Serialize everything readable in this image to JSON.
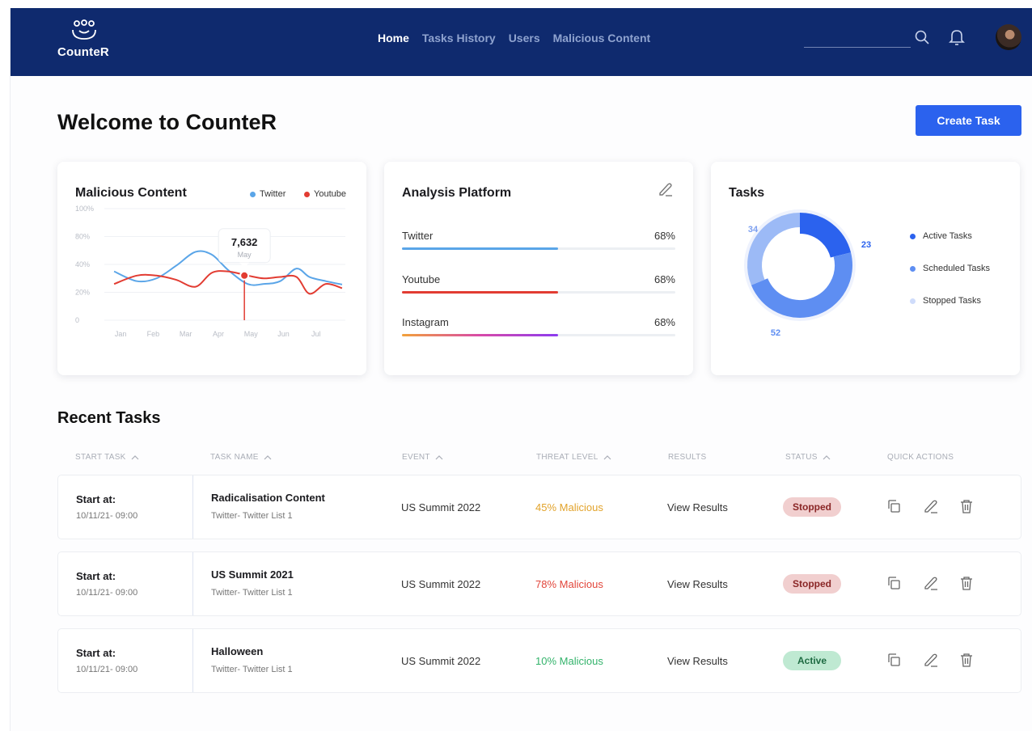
{
  "brand": {
    "name": "CounteR"
  },
  "nav": {
    "items": [
      {
        "label": "Home",
        "active": true
      },
      {
        "label": "Tasks History",
        "active": false
      },
      {
        "label": "Users",
        "active": false
      },
      {
        "label": "Malicious Content",
        "active": false
      }
    ]
  },
  "header": {
    "search_value": "",
    "icons": [
      "search-icon",
      "bell-icon",
      "avatar"
    ]
  },
  "page": {
    "title": "Welcome to CounteR",
    "create_button": "Create Task"
  },
  "malicious_card": {
    "title": "Malicious Content",
    "legend": [
      {
        "label": "Twitter",
        "color": "#5aa5e8"
      },
      {
        "label": "Youtube",
        "color": "#e23c32"
      }
    ],
    "tooltip": {
      "value": "7,632",
      "label": "May"
    }
  },
  "chart_data": {
    "type": "line",
    "title": "Malicious Content",
    "categories": [
      "Jan",
      "Feb",
      "Mar",
      "Apr",
      "May",
      "Jun",
      "Jul"
    ],
    "y_ticks": [
      "100%",
      "80%",
      "40%",
      "20%",
      "0"
    ],
    "ylim": [
      0,
      4
    ],
    "series": [
      {
        "name": "Twitter",
        "color": "#5aa5e8",
        "x": [
          0.3,
          1.0,
          1.6,
          2.2,
          2.8,
          3.3,
          3.8,
          4.4,
          4.9,
          5.4,
          5.9,
          6.3,
          6.8,
          7.3
        ],
        "y": [
          1.75,
          1.4,
          1.5,
          1.95,
          2.45,
          2.35,
          1.8,
          1.3,
          1.3,
          1.4,
          1.85,
          1.55,
          1.4,
          1.28
        ]
      },
      {
        "name": "Youtube",
        "color": "#e23c32",
        "x": [
          0.3,
          1.0,
          1.6,
          2.2,
          2.8,
          3.3,
          3.8,
          4.4,
          4.9,
          5.4,
          5.9,
          6.3,
          6.8,
          7.3
        ],
        "y": [
          1.3,
          1.6,
          1.6,
          1.45,
          1.2,
          1.7,
          1.75,
          1.6,
          1.5,
          1.55,
          1.55,
          0.95,
          1.3,
          1.15
        ]
      }
    ],
    "highlight": {
      "series": "Youtube",
      "x": 4.3,
      "y": 1.6,
      "value": "7,632",
      "label": "May"
    },
    "grid": true,
    "legend": "top-right"
  },
  "platform_card": {
    "title": "Analysis Platform",
    "items": [
      {
        "label": "Twitter",
        "pct_label": "68%",
        "fill": 0.57,
        "color": "#5aa5e8"
      },
      {
        "label": "Youtube",
        "pct_label": "68%",
        "fill": 0.57,
        "color": "#e23c32"
      },
      {
        "label": "Instagram",
        "pct_label": "68%",
        "fill": 0.57,
        "color": "gradient-orange-purple"
      }
    ]
  },
  "tasks_card": {
    "title": "Tasks",
    "donut": [
      {
        "label": "Active Tasks",
        "value": 23,
        "color": "#2b62ee"
      },
      {
        "label": "Scheduled Tasks",
        "value": 52,
        "color": "#5e8ef2"
      },
      {
        "label": "Stopped Tasks",
        "value": 34,
        "color": "#9cbaf6"
      }
    ],
    "value_labels": [
      "34",
      "23",
      "52"
    ],
    "legend_dot_colors": [
      "#2b62ee",
      "#5e8ef2",
      "#cfdcfb"
    ]
  },
  "recent": {
    "title": "Recent Tasks",
    "columns": [
      "START TASK",
      "TASK NAME",
      "EVENT",
      "THREAT LEVEL",
      "RESULTS",
      "STATUS",
      "QUICK ACTIONS"
    ],
    "sortable": [
      true,
      true,
      true,
      true,
      false,
      true,
      false
    ],
    "rows": [
      {
        "start_label": "Start at:",
        "start_date": "10/11/21- 09:00",
        "name": "Radicalisation Content",
        "sub": "Twitter- Twitter List 1",
        "event": "US Summit 2022",
        "threat": "45% Malicious",
        "threat_color": "#e2a32b",
        "results": "View Results",
        "status": "Stopped",
        "status_bg": "#f1cfcf",
        "status_fg": "#8a2626"
      },
      {
        "start_label": "Start at:",
        "start_date": "10/11/21- 09:00",
        "name": "US Summit 2021",
        "sub": "Twitter- Twitter List 1",
        "event": "US Summit 2022",
        "threat": "78% Malicious",
        "threat_color": "#e2453a",
        "results": "View Results",
        "status": "Stopped",
        "status_bg": "#f1cfcf",
        "status_fg": "#8a2626"
      },
      {
        "start_label": "Start at:",
        "start_date": "10/11/21- 09:00",
        "name": "Halloween",
        "sub": "Twitter- Twitter List 1",
        "event": "US Summit 2022",
        "threat": "10% Malicious",
        "threat_color": "#33b36b",
        "results": "View Results",
        "status": "Active",
        "status_bg": "#bfe9d2",
        "status_fg": "#1e6b42"
      }
    ],
    "actions": [
      "copy-icon",
      "edit-icon",
      "delete-icon"
    ]
  }
}
